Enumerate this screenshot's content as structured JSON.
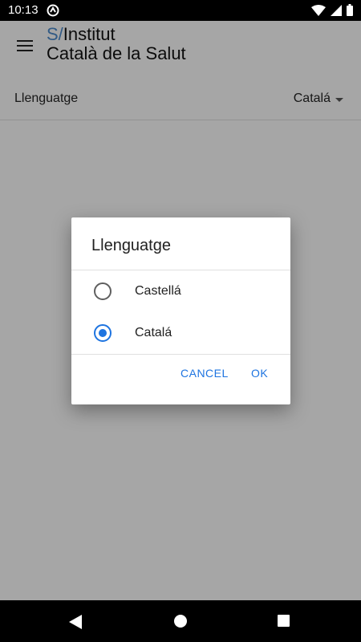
{
  "status_bar": {
    "time": "10:13",
    "icons": [
      "app-notification-icon",
      "wifi-icon",
      "signal-icon",
      "battery-icon"
    ]
  },
  "toolbar": {
    "brand_prefix": "S/",
    "brand_line1": "Institut",
    "brand_line2": "Català de la Salut"
  },
  "settings": {
    "language_label": "Llenguatge",
    "language_value": "Catalá"
  },
  "dialog": {
    "title": "Llenguatge",
    "options": [
      {
        "label": "Castellá",
        "selected": false
      },
      {
        "label": "Catalá",
        "selected": true
      }
    ],
    "cancel_label": "CANCEL",
    "ok_label": "OK"
  },
  "colors": {
    "accent": "#1e74e0",
    "brand_blue": "#4a86c5"
  }
}
